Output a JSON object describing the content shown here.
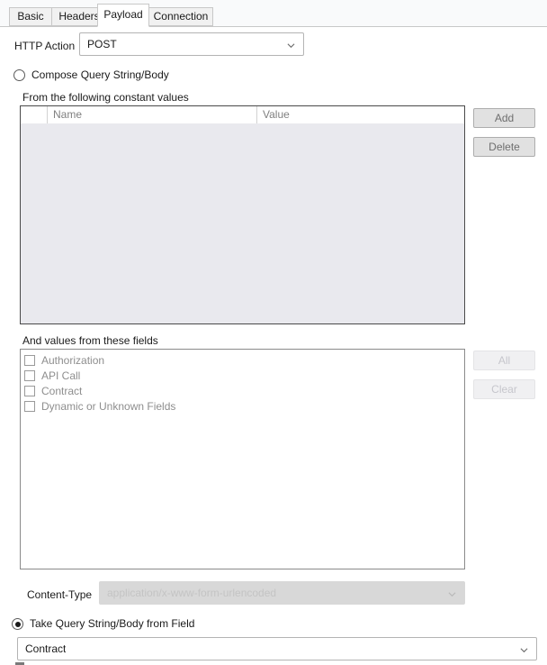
{
  "tabs": [
    {
      "label": "Basic",
      "selected": false
    },
    {
      "label": "Headers",
      "selected": false
    },
    {
      "label": "Payload",
      "selected": true
    },
    {
      "label": "Connection",
      "selected": false
    }
  ],
  "http_action": {
    "label": "HTTP Action",
    "value": "POST"
  },
  "compose_option": {
    "label": "Compose Query String/Body",
    "selected": false
  },
  "constants": {
    "caption": "From the following constant values",
    "columns": [
      "",
      "Name",
      "Value"
    ],
    "rows": [],
    "add_label": "Add",
    "delete_label": "Delete"
  },
  "fields": {
    "caption": "And values from these fields",
    "items": [
      {
        "label": "Authorization",
        "checked": false
      },
      {
        "label": "API Call",
        "checked": false
      },
      {
        "label": "Contract",
        "checked": false
      },
      {
        "label": "Dynamic or Unknown Fields",
        "checked": false
      }
    ],
    "all_label": "All",
    "clear_label": "Clear"
  },
  "content_type": {
    "label": "Content-Type",
    "value": "application/x-www-form-urlencoded"
  },
  "take_from_field_option": {
    "label": "Take Query String/Body from Field",
    "selected": true,
    "value": "Contract"
  }
}
